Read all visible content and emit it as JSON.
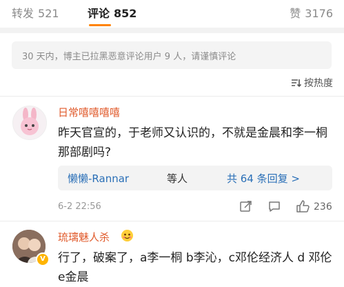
{
  "tabs": {
    "repost_label": "转发",
    "repost_count": "521",
    "comment_label": "评论",
    "comment_count": "852",
    "like_label": "赞",
    "like_count": "3176"
  },
  "notice": "30 天内，博主已拉黑恶意评论用户 9 人，请谨慎评论",
  "sort_label": "按热度",
  "comments": [
    {
      "username": "日常嘻嘻嘻嘻",
      "text": "昨天官宣的，于老师又认识的，不就是金晨和李一桐那部剧吗?",
      "replies_user": "懒懒-Rannar",
      "replies_rest": "等人",
      "replies_more": "共 64 条回复 >",
      "time": "6-2 22:56",
      "like_count": "236"
    },
    {
      "username": "琉璃魅人杀",
      "text": "行了，破案了，a李一桐 b李沁，c邓伦经济人 d 邓伦  e金晨"
    }
  ],
  "colors": {
    "accent": "#ff8200",
    "username": "#e05a2b",
    "link": "#2a6fb7"
  }
}
